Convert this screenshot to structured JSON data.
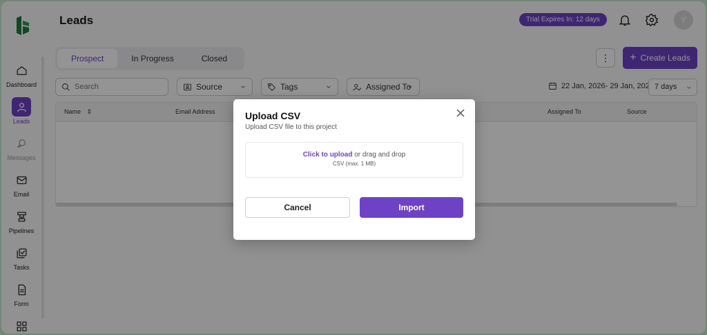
{
  "header": {
    "title": "Leads",
    "trial_badge": "Trial Expires In: 12 days",
    "avatar_initial": "Y"
  },
  "sidebar": {
    "items": [
      {
        "label": "Dashboard",
        "icon": "home-icon"
      },
      {
        "label": "Leads",
        "icon": "user-icon",
        "active": true
      },
      {
        "label": "Messages",
        "icon": "chat-icon",
        "muted": true
      },
      {
        "label": "Email",
        "icon": "mail-icon"
      },
      {
        "label": "Pipelines",
        "icon": "pipeline-icon"
      },
      {
        "label": "Tasks",
        "icon": "tasks-icon"
      },
      {
        "label": "Form",
        "icon": "form-icon"
      }
    ]
  },
  "tabs": [
    "Prospect",
    "In Progress",
    "Closed"
  ],
  "toolbar": {
    "create_label": "Create Leads",
    "kebab": "⋮"
  },
  "filters": {
    "search_placeholder": "Search",
    "source": "Source",
    "tags": "Tags",
    "assigned_to": "Assigned To",
    "date_range": "22 Jan, 2026- 29 Jan, 2026",
    "days": "7 days"
  },
  "table": {
    "columns": {
      "name": "Name",
      "email": "Email Address",
      "assigned": "Assigned To",
      "source": "Source"
    }
  },
  "modal": {
    "title": "Upload CSV",
    "subtitle": "Upload CSV file to this project",
    "upload_link": "Click to upload",
    "upload_rest": " or drag and drop",
    "upload_hint": "CSV (max. 1 MB)",
    "cancel": "Cancel",
    "import": "Import"
  },
  "colors": {
    "accent": "#6d42c7"
  }
}
